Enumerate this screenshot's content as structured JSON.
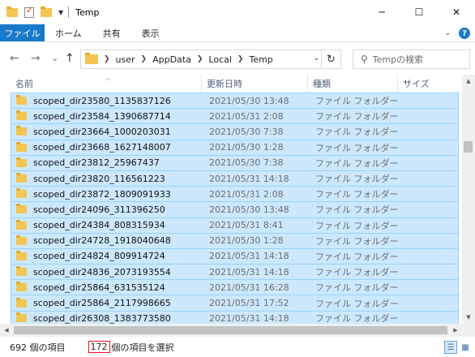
{
  "window": {
    "title": "Temp",
    "minimize": "─",
    "maximize": "☐",
    "close": "✕"
  },
  "ribbon": {
    "file_tab": "ファイル",
    "tabs": [
      "ホーム",
      "共有",
      "表示"
    ]
  },
  "nav": {
    "back": "←",
    "forward": "→",
    "recent": "⌄",
    "up": "↑",
    "breadcrumb": [
      "user",
      "AppData",
      "Local",
      "Temp"
    ],
    "refresh": "↻",
    "search_placeholder": "Tempの検索"
  },
  "columns": {
    "name": "名前",
    "modified": "更新日時",
    "type": "種類",
    "size": "サイズ"
  },
  "rows": [
    {
      "name": "scoped_dir23580_1135837126",
      "date": "2021/05/30 13:48",
      "type": "ファイル フォルダー"
    },
    {
      "name": "scoped_dir23584_1390687714",
      "date": "2021/05/31 2:08",
      "type": "ファイル フォルダー"
    },
    {
      "name": "scoped_dir23664_1000203031",
      "date": "2021/05/30 7:38",
      "type": "ファイル フォルダー"
    },
    {
      "name": "scoped_dir23668_1627148007",
      "date": "2021/05/30 1:28",
      "type": "ファイル フォルダー"
    },
    {
      "name": "scoped_dir23812_25967437",
      "date": "2021/05/30 7:38",
      "type": "ファイル フォルダー"
    },
    {
      "name": "scoped_dir23820_116561223",
      "date": "2021/05/31 14:18",
      "type": "ファイル フォルダー"
    },
    {
      "name": "scoped_dir23872_1809091933",
      "date": "2021/05/31 2:08",
      "type": "ファイル フォルダー"
    },
    {
      "name": "scoped_dir24096_311396250",
      "date": "2021/05/30 13:48",
      "type": "ファイル フォルダー"
    },
    {
      "name": "scoped_dir24384_808315934",
      "date": "2021/05/31 8:41",
      "type": "ファイル フォルダー"
    },
    {
      "name": "scoped_dir24728_1918040648",
      "date": "2021/05/30 1:28",
      "type": "ファイル フォルダー"
    },
    {
      "name": "scoped_dir24824_809914724",
      "date": "2021/05/31 14:18",
      "type": "ファイル フォルダー"
    },
    {
      "name": "scoped_dir24836_2073193554",
      "date": "2021/05/31 14:18",
      "type": "ファイル フォルダー"
    },
    {
      "name": "scoped_dir25864_631535124",
      "date": "2021/05/31 16:28",
      "type": "ファイル フォルダー"
    },
    {
      "name": "scoped_dir25864_2117998665",
      "date": "2021/05/31 17:52",
      "type": "ファイル フォルダー"
    },
    {
      "name": "scoped_dir26308_1383773580",
      "date": "2021/05/31 14:18",
      "type": "ファイル フォルダー"
    }
  ],
  "status": {
    "item_count": "692 個の項目",
    "selected_number": "172",
    "selected_suffix": "個の項目を選択"
  }
}
